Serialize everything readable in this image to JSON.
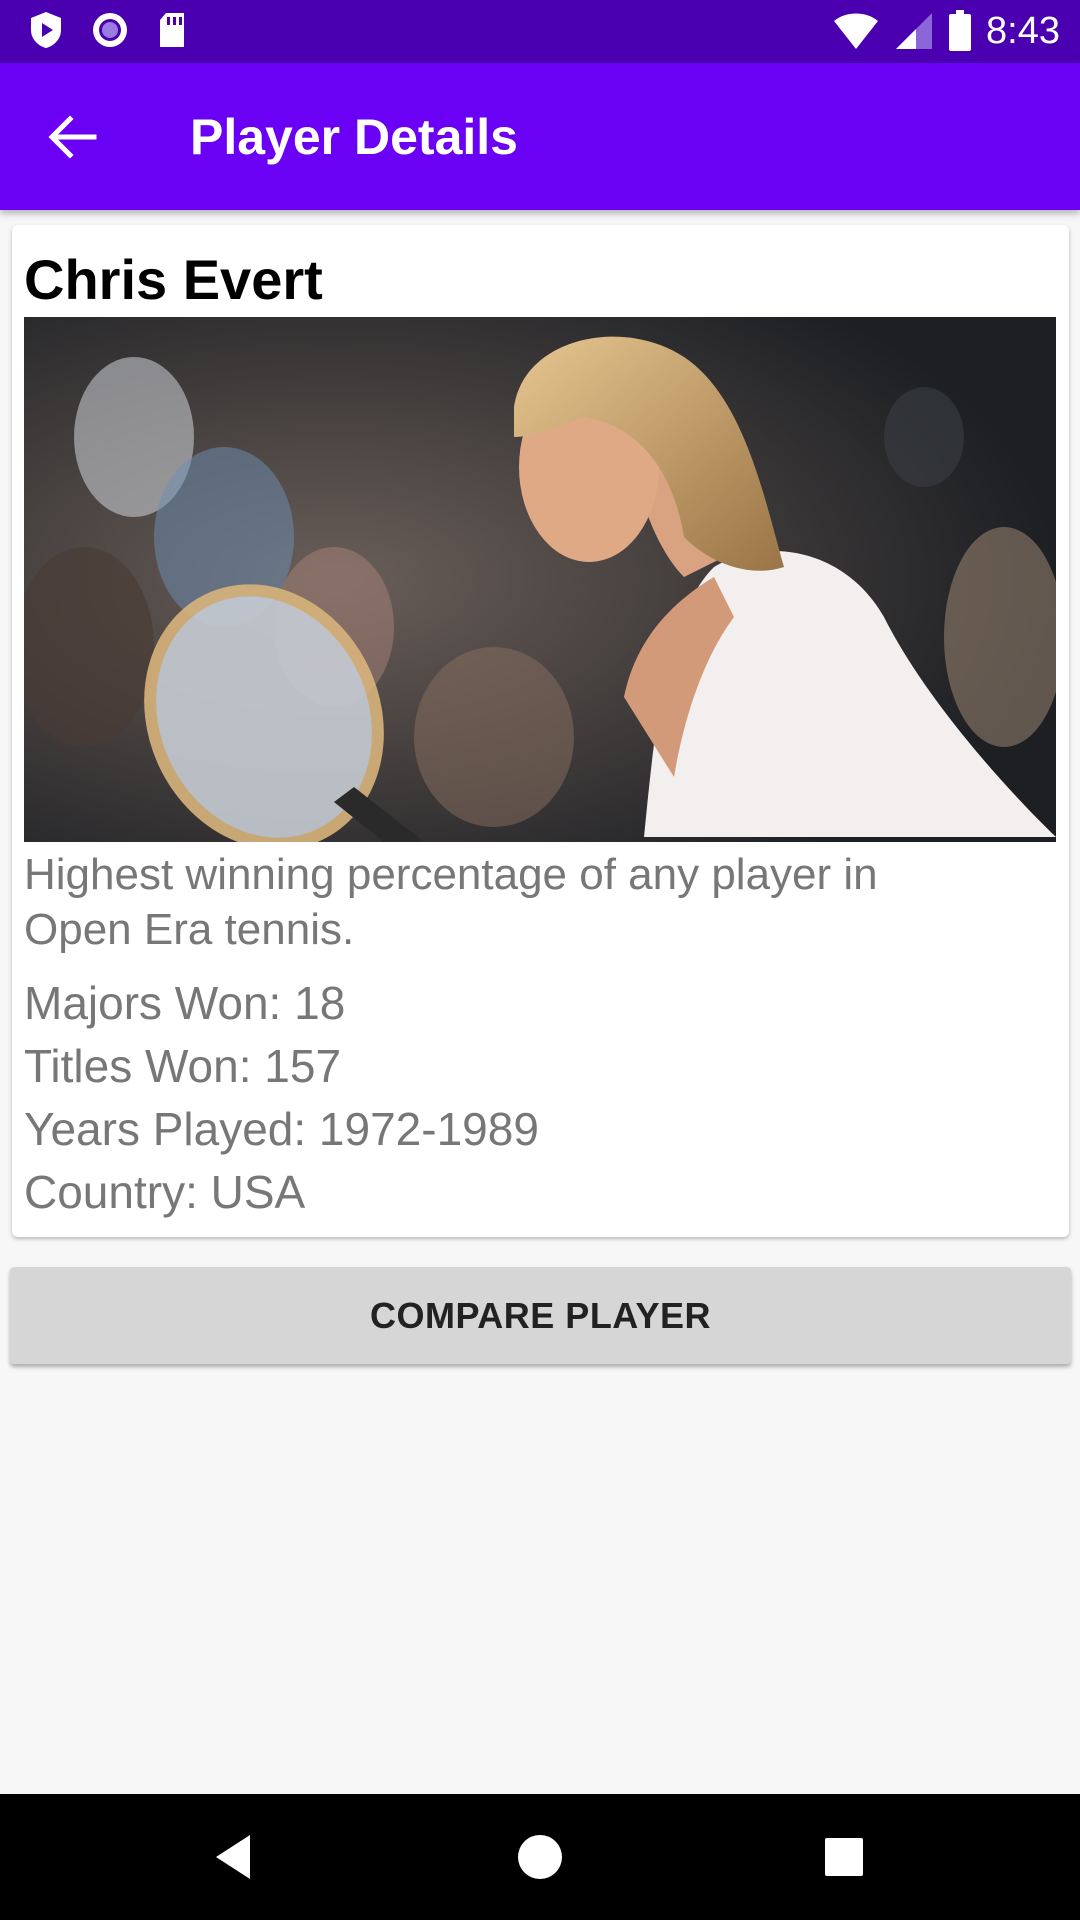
{
  "status_bar": {
    "time": "8:43",
    "icons": [
      "play-protect-icon",
      "circle-notification-icon",
      "sd-card-icon",
      "wifi-icon",
      "signal-icon",
      "battery-icon"
    ]
  },
  "app_bar": {
    "title": "Player Details",
    "back_icon": "arrow-back-icon",
    "background": "#6a00f4",
    "status_background": "#4a00b0"
  },
  "player": {
    "name": "Chris Evert",
    "description": "Highest winning percentage of any player in Open Era tennis.",
    "stats": [
      "Majors Won: 18",
      "Titles Won: 157",
      "Years Played: 1972-1989",
      "Country: USA"
    ]
  },
  "actions": {
    "compare_label": "COMPARE PLAYER"
  },
  "nav_bar": {
    "icons": [
      "back-triangle-icon",
      "home-circle-icon",
      "recents-square-icon"
    ]
  }
}
